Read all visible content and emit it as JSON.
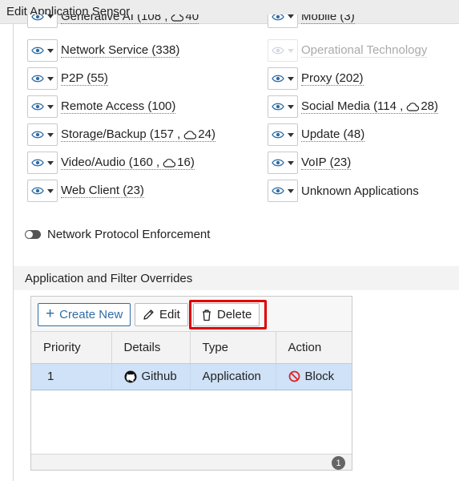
{
  "window": {
    "title": "Edit Application Sensor"
  },
  "categories": {
    "left": [
      {
        "id": "generative-ai",
        "name": "Generative AI",
        "count": "(108 ,",
        "cloud_count": "40"
      },
      {
        "id": "network-service",
        "label": "Network Service (338)"
      },
      {
        "id": "p2p",
        "label": "P2P (55)"
      },
      {
        "id": "remote-access",
        "label": "Remote Access (100)"
      },
      {
        "id": "storage-backup",
        "name": "Storage/Backup",
        "count": "(157 ,",
        "cloud_count": "24)"
      },
      {
        "id": "video-audio",
        "name": "Video/Audio",
        "count": "(160 ,",
        "cloud_count": "16)"
      },
      {
        "id": "web-client",
        "label": "Web Client (23)"
      }
    ],
    "right": [
      {
        "id": "mobile",
        "label": "Mobile (3)"
      },
      {
        "id": "operational-technology",
        "label": "Operational Technology",
        "disabled": true
      },
      {
        "id": "proxy",
        "label": "Proxy (202)"
      },
      {
        "id": "social-media",
        "name": "Social Media",
        "count": "(114 ,",
        "cloud_count": "28)"
      },
      {
        "id": "update",
        "label": "Update (48)"
      },
      {
        "id": "voip",
        "label": "VoIP (23)"
      },
      {
        "id": "unknown-applications",
        "label": "Unknown Applications"
      }
    ],
    "action_icon": "eye-icon"
  },
  "network_protocol_enforcement": {
    "label": "Network Protocol Enforcement",
    "enabled": false
  },
  "overrides": {
    "section_title": "Application and Filter Overrides",
    "toolbar": {
      "create_label": "Create New",
      "edit_label": "Edit",
      "delete_label": "Delete",
      "create_icon": "plus-icon",
      "edit_icon": "pencil-icon",
      "delete_icon": "trash-icon"
    },
    "columns": [
      "Priority",
      "Details",
      "Type",
      "Action"
    ],
    "rows": [
      {
        "priority": "1",
        "details": "Github",
        "details_icon": "github-icon",
        "type": "Application",
        "action": "Block",
        "action_icon": "block-icon",
        "selected": true
      }
    ],
    "total_count": "1"
  },
  "colors": {
    "accent": "#2f6da6",
    "highlight_box": "#e00000",
    "selected_row": "#cfe2f7",
    "block_icon": "#d9262c"
  }
}
